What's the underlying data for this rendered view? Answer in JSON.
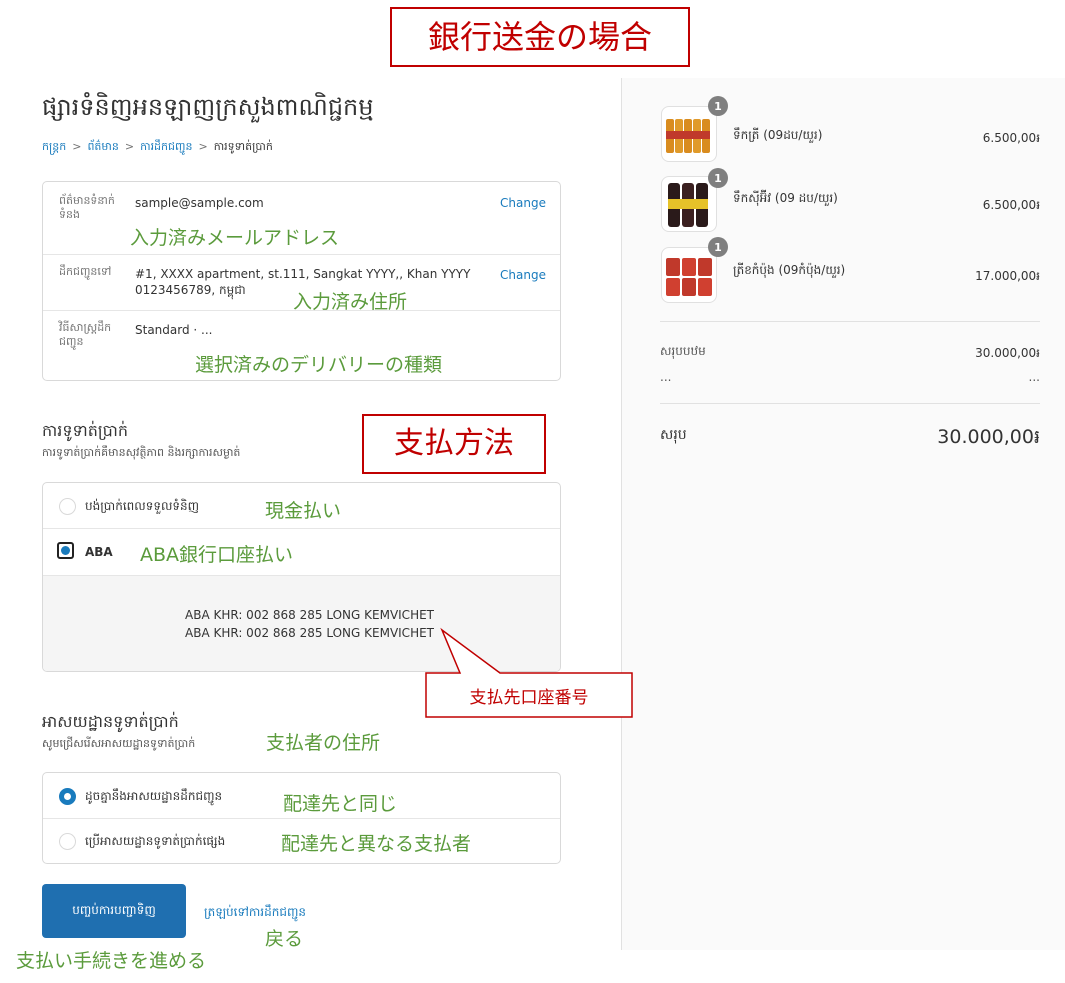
{
  "annotations": {
    "title": "銀行送金の場合",
    "email_filled": "入力済みメールアドレス",
    "address_filled": "入力済み住所",
    "delivery_type": "選択済みのデリバリーの種類",
    "payment_method": "支払方法",
    "cash": "現金払い",
    "aba": "ABA銀行口座払い",
    "account_number": "支払先口座番号",
    "billing_address": "支払者の住所",
    "same_address": "配達先と同じ",
    "different_address": "配達先と異なる支払者",
    "proceed": "支払い手続きを進める",
    "back": "戻る"
  },
  "store": {
    "title": "ផ្សារទំនិញអនឡាញក្រសួងពាណិជ្ជកម្ម"
  },
  "breadcrumb": {
    "cart": "កន្ត្រក",
    "info": "ព័ត៌មាន",
    "shipping": "ការដឹកជញ្ជូន",
    "payment": "ការទូទាត់ប្រាក់",
    "separator": ">"
  },
  "review": {
    "contact_label": "ព័ត៌មានទំនាក់ទំនង",
    "contact_value": "sample@sample.com",
    "ship_to_label": "ដឹកជញ្ជូនទៅ",
    "ship_to_line1": "#1, XXXX apartment, st.111, Sangkat YYYY,, Khan YYYY",
    "ship_to_line2": "0123456789, កម្ពុជា",
    "method_label": "វិធីសាស្ត្រដឹកជញ្ជូន",
    "method_value": "Standard · ...",
    "change_label": "Change"
  },
  "payment": {
    "title": "ការទូទាត់ប្រាក់",
    "subtitle": "ការទូទាត់ប្រាក់គឺមានសុវត្ថិភាព និងរក្សាការសម្ងាត់",
    "cod_label": "បង់ប្រាក់ពេលទទួលទំនិញ",
    "aba_label": "ABA",
    "aba_line1": "ABA KHR: 002 868 285 LONG KEMVICHET",
    "aba_line2": "ABA KHR: 002 868 285 LONG KEMVICHET"
  },
  "billing": {
    "title": "អាសយដ្ឋានទូទាត់ប្រាក់",
    "subtitle": "សូមជ្រើសរើសអាសយដ្ឋានទូទាត់ប្រាក់",
    "same_label": "ដូចគ្នានឹងអាសយដ្ឋានដឹកជញ្ជូន",
    "diff_label": "ប្រើអាសយដ្ឋានទូទាត់ប្រាក់ផ្សេង"
  },
  "actions": {
    "complete": "បញ្ចប់ការបញ្ជាទិញ",
    "return": "ត្រឡប់ទៅការដឹកជញ្ជូន"
  },
  "summary": {
    "items": [
      {
        "name": "ទឹកត្រី (09ដប/យួរ)",
        "price": "6.500,00៛",
        "qty": "1"
      },
      {
        "name": "ទឹកស៊ីអ៊ីវ (09 ដប/យួរ)",
        "price": "6.500,00៛",
        "qty": "1"
      },
      {
        "name": "ត្រីខកំប៉ុង (09កំប៉ុង/យួរ)",
        "price": "17.000,00៛",
        "qty": "1"
      }
    ],
    "subtotal_label": "សរុបបឋម",
    "subtotal_value": "30.000,00៛",
    "shipping_label": "...",
    "shipping_value": "...",
    "total_label": "សរុប",
    "total_value": "30.000,00៛"
  },
  "colors": {
    "link": "#197bbd",
    "button": "#1f6fb0",
    "annotation_green": "#5b9b3c",
    "annotation_red": "#c00000"
  }
}
